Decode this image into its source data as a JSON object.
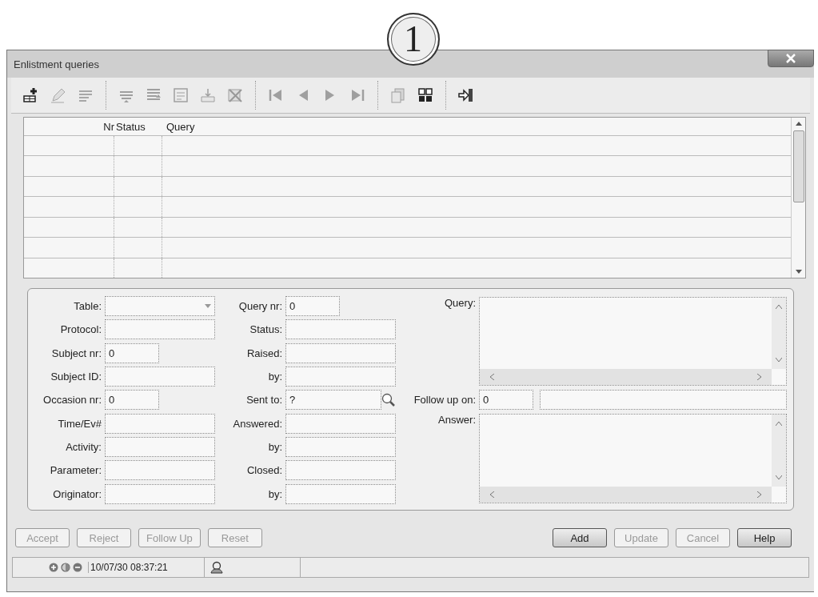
{
  "callout": {
    "label": "1"
  },
  "window": {
    "title": "Enlistment queries"
  },
  "toolbar": {
    "groups": [
      {
        "items": [
          {
            "kind": "add",
            "disabled": false
          },
          {
            "kind": "pencil",
            "disabled": true
          },
          {
            "kind": "list",
            "disabled": true
          }
        ]
      },
      {
        "items": [
          {
            "kind": "lines",
            "disabled": true
          },
          {
            "kind": "sort",
            "disabled": true
          },
          {
            "kind": "form",
            "disabled": true
          },
          {
            "kind": "tray",
            "disabled": true
          },
          {
            "kind": "delete",
            "disabled": true
          }
        ]
      },
      {
        "items": [
          {
            "kind": "first",
            "disabled": true
          },
          {
            "kind": "prev",
            "disabled": true
          },
          {
            "kind": "next",
            "disabled": true
          },
          {
            "kind": "last",
            "disabled": true
          }
        ]
      },
      {
        "items": [
          {
            "kind": "copy",
            "disabled": true
          },
          {
            "kind": "grid",
            "disabled": false
          }
        ]
      },
      {
        "items": [
          {
            "kind": "exit",
            "disabled": false
          }
        ]
      }
    ]
  },
  "grid": {
    "columns": [
      {
        "label": "Nr"
      },
      {
        "label": "Status"
      },
      {
        "label": "Query"
      }
    ]
  },
  "form": {
    "left": [
      {
        "label": "Table:",
        "kind": "dropdown"
      },
      {
        "label": "Protocol:",
        "kind": "text"
      },
      {
        "label": "Subject nr:",
        "kind": "short",
        "value": "0"
      },
      {
        "label": "Subject ID:",
        "kind": "text"
      },
      {
        "label": "Occasion nr:",
        "kind": "short",
        "value": "0"
      },
      {
        "label": "Time/Ev#",
        "kind": "text"
      },
      {
        "label": "Activity:",
        "kind": "text"
      },
      {
        "label": "Parameter:",
        "kind": "text"
      },
      {
        "label": "Originator:",
        "kind": "text"
      }
    ],
    "middle": [
      {
        "label": "Query nr:",
        "kind": "short",
        "value": "0"
      },
      {
        "label": "Status:",
        "kind": "text"
      },
      {
        "label": "Raised:",
        "kind": "text"
      },
      {
        "label": "by:",
        "kind": "text"
      },
      {
        "label": "Sent to:",
        "kind": "lookup",
        "value": "?"
      },
      {
        "label": "Answered:",
        "kind": "text"
      },
      {
        "label": "by:",
        "kind": "text"
      },
      {
        "label": "Closed:",
        "kind": "text"
      },
      {
        "label": "by:",
        "kind": "text"
      }
    ],
    "query": {
      "label": "Query:"
    },
    "follow_up": {
      "label": "Follow up on:",
      "value": "0"
    },
    "answer": {
      "label": "Answer:"
    }
  },
  "buttons_left": [
    {
      "label": "Accept",
      "disabled": true
    },
    {
      "label": "Reject",
      "disabled": true
    },
    {
      "label": "Follow Up",
      "disabled": true
    },
    {
      "label": "Reset",
      "disabled": true
    }
  ],
  "buttons_right": [
    {
      "label": "Add",
      "disabled": false
    },
    {
      "label": "Update",
      "disabled": true
    },
    {
      "label": "Cancel",
      "disabled": true
    },
    {
      "label": "Help",
      "disabled": false
    }
  ],
  "status_bar": {
    "timestamp": "10/07/30 08:37:21"
  }
}
